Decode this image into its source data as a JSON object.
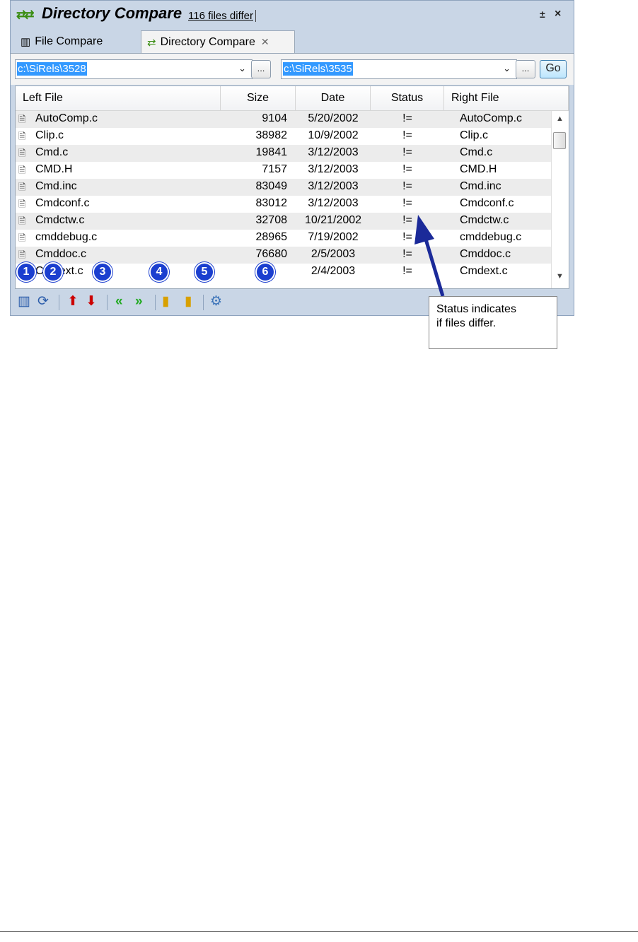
{
  "window": {
    "title": "Directory Compare",
    "subtitle": "116 files differ",
    "pin_glyph": "±",
    "close_glyph": "×"
  },
  "tabs": [
    {
      "label": "File Compare",
      "icon": "file-compare-icon"
    },
    {
      "label": "Directory Compare",
      "icon": "directory-compare-icon",
      "active": true
    }
  ],
  "paths": {
    "left": "c:\\SiRels\\3528",
    "right": "c:\\SiRels\\3535",
    "browse_label": "...",
    "go_label": "Go"
  },
  "columns": {
    "left_file": "Left File",
    "size": "Size",
    "date": "Date",
    "status": "Status",
    "right_file": "Right File"
  },
  "rows": [
    {
      "left": "AutoComp.c",
      "size": "9104",
      "date": "5/20/2002",
      "status": "!=",
      "right": "AutoComp.c"
    },
    {
      "left": "Clip.c",
      "size": "38982",
      "date": "10/9/2002",
      "status": "!=",
      "right": "Clip.c"
    },
    {
      "left": "Cmd.c",
      "size": "19841",
      "date": "3/12/2003",
      "status": "!=",
      "right": "Cmd.c"
    },
    {
      "left": "CMD.H",
      "size": "7157",
      "date": "3/12/2003",
      "status": "!=",
      "right": "CMD.H"
    },
    {
      "left": "Cmd.inc",
      "size": "83049",
      "date": "3/12/2003",
      "status": "!=",
      "right": "Cmd.inc"
    },
    {
      "left": "Cmdconf.c",
      "size": "83012",
      "date": "3/12/2003",
      "status": "!=",
      "right": "Cmdconf.c"
    },
    {
      "left": "Cmdctw.c",
      "size": "32708",
      "date": "10/21/2002",
      "status": "!=",
      "right": "Cmdctw.c"
    },
    {
      "left": "cmddebug.c",
      "size": "28965",
      "date": "7/19/2002",
      "status": "!=",
      "right": "cmddebug.c"
    },
    {
      "left": "Cmddoc.c",
      "size": "76680",
      "date": "2/5/2003",
      "status": "!=",
      "right": "Cmddoc.c"
    },
    {
      "left": "Cmdext.c",
      "size": "",
      "date": "2/4/2003",
      "status": "!=",
      "right": "Cmdext.c"
    }
  ],
  "badges": [
    "1",
    "2",
    "3",
    "4",
    "5",
    "6"
  ],
  "callout": {
    "line1": "Status indicates",
    "line2": "if files differ."
  }
}
